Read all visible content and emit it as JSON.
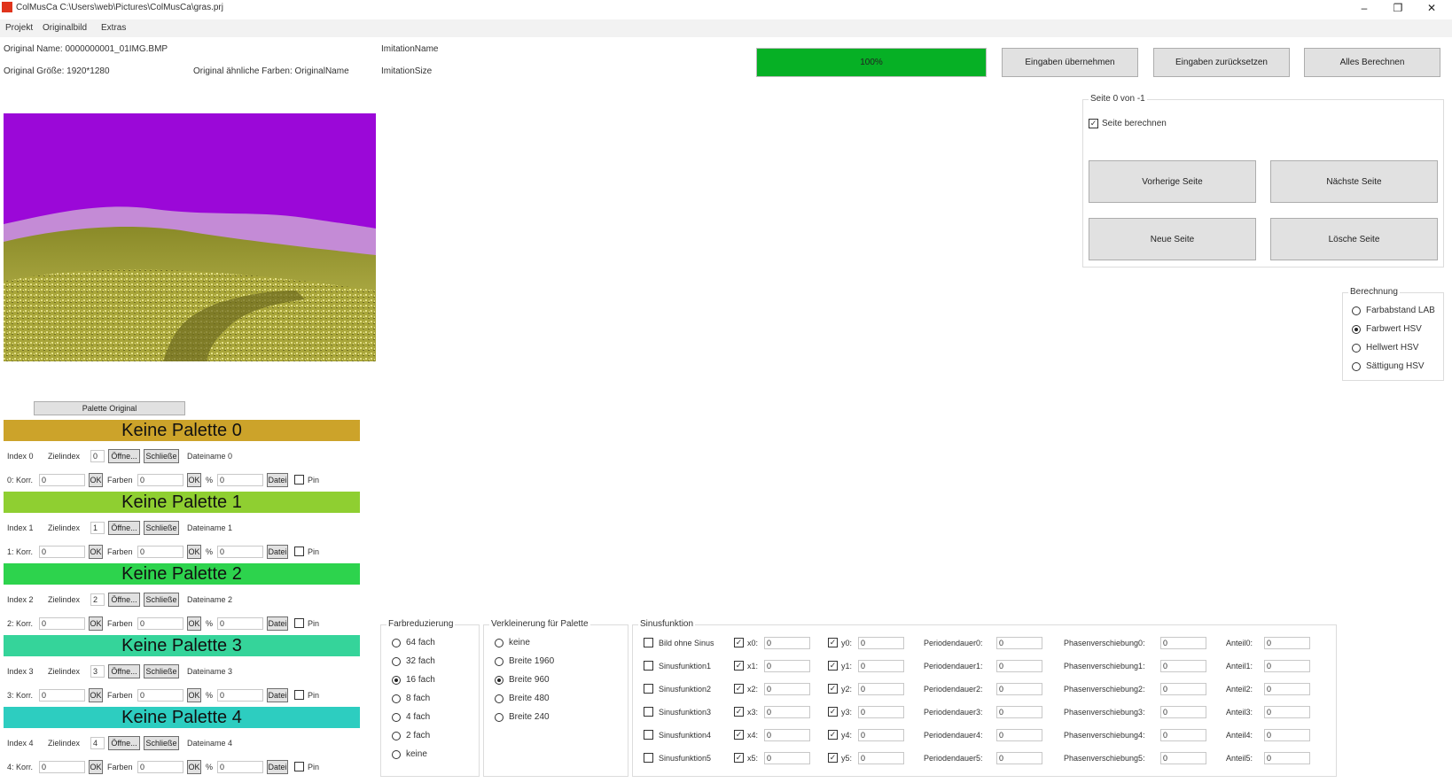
{
  "window": {
    "title": "ColMusCa C:\\Users\\web\\Pictures\\ColMusCa\\gras.prj"
  },
  "menu": {
    "items": [
      "Projekt",
      "Originalbild",
      "Extras"
    ]
  },
  "info": {
    "orig_name": "Original Name: 0000000001_01IMG.BMP",
    "orig_size": "Original Größe: 1920*1280",
    "orig_similar": "Original ähnliche Farben: OriginalName",
    "imit_name": "ImitationName",
    "imit_size": "ImitationSize"
  },
  "progress": {
    "label": "100%",
    "value": 100,
    "color": "#06b025"
  },
  "top_buttons": {
    "apply": "Eingaben übernehmen",
    "reset": "Eingaben zurücksetzen",
    "compute_all": "Alles Berechnen"
  },
  "page_panel": {
    "legend": "Seite 0 von -1",
    "compute_page": "Seite berechnen",
    "compute_checked": true,
    "prev": "Vorherige Seite",
    "next": "Nächste Seite",
    "new": "Neue Seite",
    "delete": "Lösche Seite"
  },
  "calc": {
    "legend": "Berechnung",
    "options": [
      {
        "label": "Farbabstand LAB",
        "selected": false
      },
      {
        "label": "Farbwert HSV",
        "selected": true
      },
      {
        "label": "Hellwert HSV",
        "selected": false
      },
      {
        "label": "Sättigung HSV",
        "selected": false
      }
    ]
  },
  "palette_original_button": "Palette Original",
  "palettes": [
    {
      "title": "Keine Palette 0",
      "color": "#cca32a",
      "index_label": "Index 0",
      "ziel_label": "Zielindex",
      "ziel_value": "0",
      "open": "Öffne...",
      "close": "Schließe",
      "file": "Dateiname 0",
      "korr_label": "0: Korr.",
      "korr_value": "0",
      "ok": "OK",
      "farben_label": "Farben",
      "farben_value": "0",
      "pct": "%",
      "pct_value": "0",
      "date": "Datei",
      "pin": "Pin"
    },
    {
      "title": "Keine Palette 1",
      "color": "#8fcf31",
      "index_label": "Index 1",
      "ziel_label": "Zielindex",
      "ziel_value": "1",
      "open": "Öffne...",
      "close": "Schließe",
      "file": "Dateiname 1",
      "korr_label": "1: Korr.",
      "korr_value": "0",
      "ok": "OK",
      "farben_label": "Farben",
      "farben_value": "0",
      "pct": "%",
      "pct_value": "0",
      "date": "Datei",
      "pin": "Pin"
    },
    {
      "title": "Keine Palette 2",
      "color": "#2dd34d",
      "index_label": "Index 2",
      "ziel_label": "Zielindex",
      "ziel_value": "2",
      "open": "Öffne...",
      "close": "Schließe",
      "file": "Dateiname 2",
      "korr_label": "2: Korr.",
      "korr_value": "0",
      "ok": "OK",
      "farben_label": "Farben",
      "farben_value": "0",
      "pct": "%",
      "pct_value": "0",
      "date": "Datei",
      "pin": "Pin"
    },
    {
      "title": "Keine Palette 3",
      "color": "#35d49a",
      "index_label": "Index 3",
      "ziel_label": "Zielindex",
      "ziel_value": "3",
      "open": "Öffne...",
      "close": "Schließe",
      "file": "Dateiname 3",
      "korr_label": "3: Korr.",
      "korr_value": "0",
      "ok": "OK",
      "farben_label": "Farben",
      "farben_value": "0",
      "pct": "%",
      "pct_value": "0",
      "date": "Datei",
      "pin": "Pin"
    },
    {
      "title": "Keine Palette 4",
      "color": "#2dcdc0",
      "index_label": "Index 4",
      "ziel_label": "Zielindex",
      "ziel_value": "4",
      "open": "Öffne...",
      "close": "Schließe",
      "file": "Dateiname 4",
      "korr_label": "4: Korr.",
      "korr_value": "0",
      "ok": "OK",
      "farben_label": "Farben",
      "farben_value": "0",
      "pct": "%",
      "pct_value": "0",
      "date": "Datei",
      "pin": "Pin"
    }
  ],
  "farbreduzierung": {
    "legend": "Farbreduzierung",
    "options": [
      {
        "label": "64 fach",
        "selected": false
      },
      {
        "label": "32 fach",
        "selected": false
      },
      {
        "label": "16 fach",
        "selected": true
      },
      {
        "label": "8 fach",
        "selected": false
      },
      {
        "label": "4 fach",
        "selected": false
      },
      {
        "label": "2 fach",
        "selected": false
      },
      {
        "label": "keine",
        "selected": false
      }
    ]
  },
  "verkleinerung": {
    "legend": "Verkleinerung für Palette",
    "options": [
      {
        "label": "keine",
        "selected": false
      },
      {
        "label": "Breite 1960",
        "selected": false
      },
      {
        "label": "Breite 960",
        "selected": true
      },
      {
        "label": "Breite 480",
        "selected": false
      },
      {
        "label": "Breite 240",
        "selected": false
      }
    ]
  },
  "sinus": {
    "legend": "Sinusfunktion",
    "rows": [
      {
        "name": "Bild ohne Sinus",
        "x": "x0:",
        "xv": "0",
        "y": "y0:",
        "yv": "0",
        "p": "Periodendauer0:",
        "pv": "0",
        "ph": "Phasenverschiebung0:",
        "phv": "0",
        "a": "Anteil0:",
        "av": "0"
      },
      {
        "name": "Sinusfunktion1",
        "x": "x1:",
        "xv": "0",
        "y": "y1:",
        "yv": "0",
        "p": "Periodendauer1:",
        "pv": "0",
        "ph": "Phasenverschiebung1:",
        "phv": "0",
        "a": "Anteil1:",
        "av": "0"
      },
      {
        "name": "Sinusfunktion2",
        "x": "x2:",
        "xv": "0",
        "y": "y2:",
        "yv": "0",
        "p": "Periodendauer2:",
        "pv": "0",
        "ph": "Phasenverschiebung2:",
        "phv": "0",
        "a": "Anteil2:",
        "av": "0"
      },
      {
        "name": "Sinusfunktion3",
        "x": "x3:",
        "xv": "0",
        "y": "y3:",
        "yv": "0",
        "p": "Periodendauer3:",
        "pv": "0",
        "ph": "Phasenverschiebung3:",
        "phv": "0",
        "a": "Anteil3:",
        "av": "0"
      },
      {
        "name": "Sinusfunktion4",
        "x": "x4:",
        "xv": "0",
        "y": "y4:",
        "yv": "0",
        "p": "Periodendauer4:",
        "pv": "0",
        "ph": "Phasenverschiebung4:",
        "phv": "0",
        "a": "Anteil4:",
        "av": "0"
      },
      {
        "name": "Sinusfunktion5",
        "x": "x5:",
        "xv": "0",
        "y": "y5:",
        "yv": "0",
        "p": "Periodendauer5:",
        "pv": "0",
        "ph": "Phasenverschiebung5:",
        "phv": "0",
        "a": "Anteil5:",
        "av": "0"
      }
    ]
  }
}
